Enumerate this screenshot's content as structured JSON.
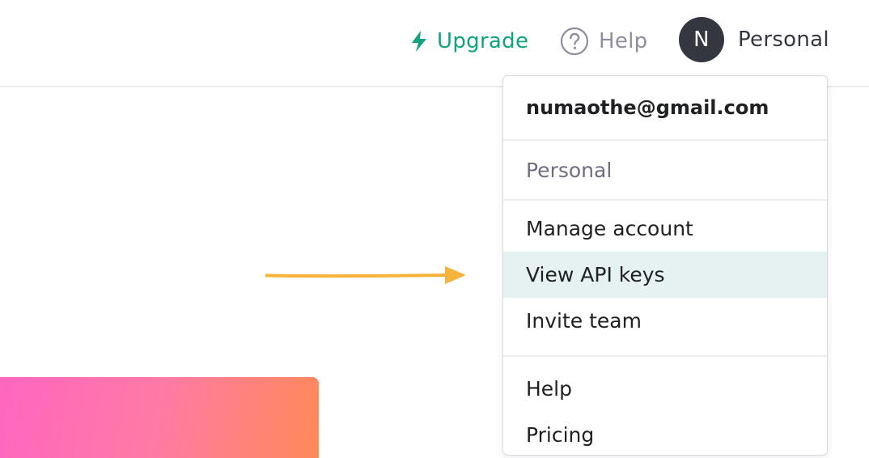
{
  "header": {
    "upgrade_label": "Upgrade",
    "help_label": "Help",
    "avatar_initial": "N",
    "account_label": "Personal"
  },
  "dropdown": {
    "email": "numaothe@gmail.com",
    "organization": "Personal",
    "account_items": [
      {
        "label": "Manage account"
      },
      {
        "label": "View API keys",
        "highlighted": true
      },
      {
        "label": "Invite team"
      }
    ],
    "more_items": [
      {
        "label": "Help"
      },
      {
        "label": "Pricing"
      }
    ]
  },
  "colors": {
    "accent": "#10a37f",
    "muted": "#8e8ea0",
    "avatar_bg": "#353740",
    "highlight_bg": "#e6f2f2",
    "arrow": "#f7b23b",
    "gradient_start": "#ff66c0",
    "gradient_end": "#ff8a58"
  },
  "icons": {
    "upgrade": "lightning-bolt-icon",
    "help": "question-circle-icon",
    "annotation": "arrow-right-icon"
  }
}
